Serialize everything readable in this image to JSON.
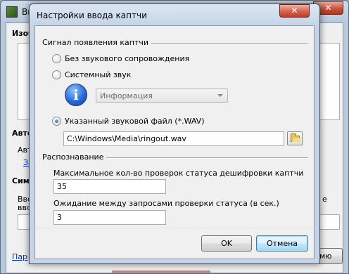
{
  "background": {
    "title": "Вы",
    "close_glyph": "✕",
    "section_image": "Изоб",
    "section_auto": "Авто",
    "auto_text": "Авт",
    "auto_link": "За",
    "section_symbols": "Симе",
    "symbols_text1": "Вве",
    "symbols_text2": "вво",
    "symbols_suffix": "е",
    "footer_link": "Пар",
    "footer_button": "мю"
  },
  "dialog": {
    "title": "Настройки ввода каптчи",
    "close_glyph": "✕",
    "signal_group": {
      "title": "Сигнал появления каптчи",
      "option_none": "Без звукового сопровождения",
      "option_system": "Системный звук",
      "system_sound_value": "Информация",
      "option_file": "Указанный звуковой файл (*.WAV)",
      "file_path": "C:\\Windows\\Media\\ringout.wav"
    },
    "recognition_group": {
      "title": "Распознавание",
      "max_checks_label": "Максимальное кол-во проверок статуса дешифровки каптчи",
      "max_checks_value": "35",
      "wait_label": "Ожидание между запросами проверки статуса (в сек.)",
      "wait_value": "3"
    },
    "ok_label": "OK",
    "cancel_label": "Отмена"
  },
  "icons": {
    "info": "info-icon",
    "folder": "folder-open-icon",
    "app": "app-icon"
  }
}
